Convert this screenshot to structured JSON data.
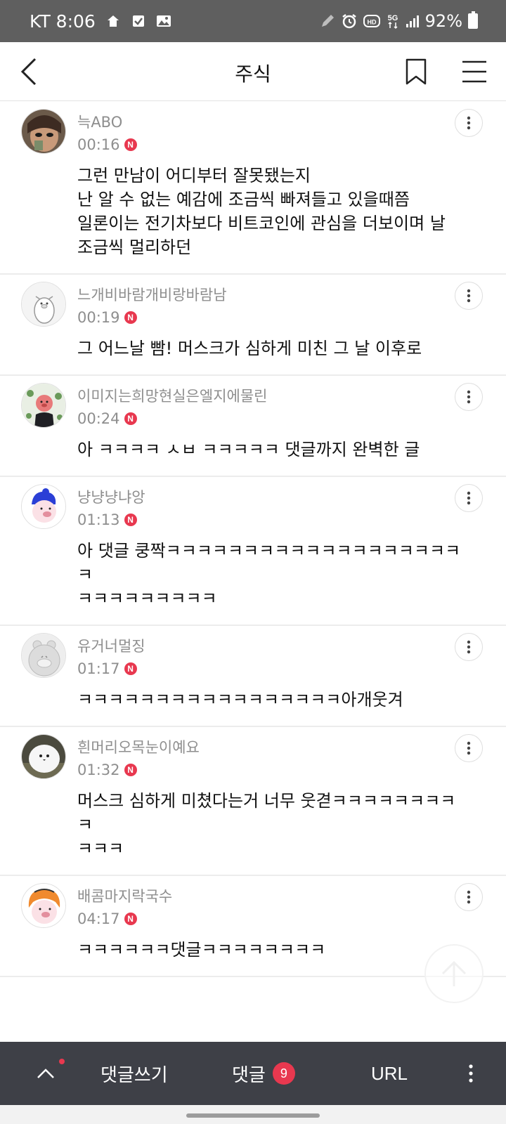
{
  "status_bar": {
    "carrier_time": "KT 8:06",
    "battery": "92%",
    "icons": [
      "home-icon",
      "check-box-icon",
      "gallery-icon",
      "pen-icon",
      "alarm-icon",
      "hd-icon",
      "5g-icon",
      "signal-icon",
      "battery-icon"
    ]
  },
  "header": {
    "title": "주식",
    "icons": [
      "back-arrow-icon",
      "bookmark-icon",
      "hamburger-menu-icon"
    ]
  },
  "comments": [
    {
      "nickname": "늑ABO",
      "time": "00:16",
      "badge": "N",
      "text": "그런 만남이 어디부터 잘못됐는지\n난 알 수 없는 예감에 조금씩 빠져들고 있을때쯤\n일론이는 전기차보다 비트코인에 관심을 더보이며 날\n조금씩 멀리하던"
    },
    {
      "nickname": "느개비바람개비랑바람남",
      "time": "00:19",
      "badge": "N",
      "text": "그 어느날 빰! 머스크가 심하게 미친 그 날 이후로"
    },
    {
      "nickname": "이미지는희망현실은엘지에물린",
      "time": "00:24",
      "badge": "N",
      "text": "아 ㅋㅋㅋㅋ ㅅㅂ ㅋㅋㅋㅋㅋ 댓글까지 완벽한 글"
    },
    {
      "nickname": "냥냥냥냐앙",
      "time": "01:13",
      "badge": "N",
      "text": "아 댓글 쿵짝ㅋㅋㅋㅋㅋㅋㅋㅋㅋㅋㅋㅋㅋㅋㅋㅋㅋㅋㅋㅋ\nㅋㅋㅋㅋㅋㅋㅋㅋㅋ"
    },
    {
      "nickname": "유거너멀징",
      "time": "01:17",
      "badge": "N",
      "text": "ㅋㅋㅋㅋㅋㅋㅋㅋㅋㅋㅋㅋㅋㅋㅋㅋㅋ아개웃겨"
    },
    {
      "nickname": "흰머리오목눈이예요",
      "time": "01:32",
      "badge": "N",
      "text": "머스크 심하게 미쳤다는거 너무 웃겯ㅋㅋㅋㅋㅋㅋㅋㅋㅋ\nㅋㅋㅋ"
    },
    {
      "nickname": "배콤마지락국수",
      "time": "04:17",
      "badge": "N",
      "text": "ㅋㅋㅋㅋㅋㅋ댓글ㅋㅋㅋㅋㅋㅋㅋㅋ"
    }
  ],
  "bottom_bar": {
    "write_label": "댓글쓰기",
    "comments_label": "댓글",
    "comments_count": "9",
    "url_label": "URL"
  },
  "colors": {
    "status_bar_bg": "#5f5f5f",
    "bottom_bar_bg": "#3e4047",
    "accent_red": "#e8384f",
    "meta_text": "#8e8e8e"
  }
}
